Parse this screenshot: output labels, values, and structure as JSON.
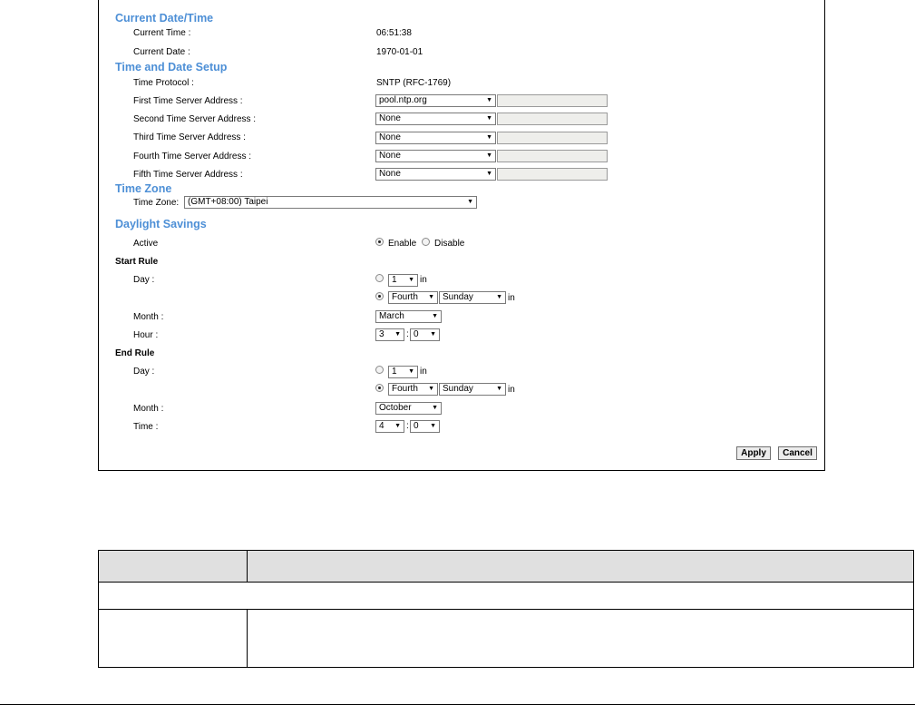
{
  "sections": {
    "current": "Current Date/Time",
    "setup": "Time and Date Setup",
    "zone": "Time Zone",
    "dst": "Daylight Savings"
  },
  "current": {
    "time_label": "Current Time :",
    "time_value": "06:51:38",
    "date_label": "Current Date :",
    "date_value": "1970-01-01"
  },
  "setup": {
    "protocol_label": "Time Protocol :",
    "protocol_value": "SNTP (RFC-1769)",
    "servers": [
      {
        "label": "First Time Server Address :",
        "value": "pool.ntp.org"
      },
      {
        "label": "Second Time Server Address :",
        "value": "None"
      },
      {
        "label": "Third Time Server Address :",
        "value": "None"
      },
      {
        "label": "Fourth Time Server Address :",
        "value": "None"
      },
      {
        "label": "Fifth Time Server Address :",
        "value": "None"
      }
    ]
  },
  "timezone": {
    "label": "Time Zone:",
    "value": "(GMT+08:00) Taipei"
  },
  "dst": {
    "active_label": "Active",
    "enable": "Enable",
    "disable": "Disable",
    "start_rule": "Start Rule",
    "end_rule": "End Rule",
    "day_label": "Day :",
    "month_label": "Month :",
    "hour_label": "Hour :",
    "time_label": "Time :",
    "in": "in",
    "colon": ":",
    "start": {
      "day": "1",
      "week": "Fourth",
      "weekday": "Sunday",
      "month": "March",
      "hour": "3",
      "minute": "0"
    },
    "end": {
      "day": "1",
      "week": "Fourth",
      "weekday": "Sunday",
      "month": "October",
      "hour": "4",
      "minute": "0"
    }
  },
  "buttons": {
    "apply": "Apply",
    "cancel": "Cancel"
  },
  "arrow": "▼"
}
